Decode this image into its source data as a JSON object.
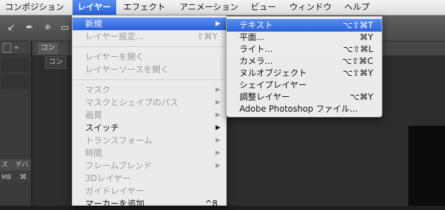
{
  "menubar": {
    "items": [
      {
        "label": "コンポジション"
      },
      {
        "label": "レイヤー"
      },
      {
        "label": "エフェクト"
      },
      {
        "label": "アニメーション"
      },
      {
        "label": "ビュー"
      },
      {
        "label": "ウィンドウ"
      },
      {
        "label": "ヘルプ"
      }
    ]
  },
  "panels": {
    "left_tab_1": "ズ",
    "left_tab_2": "デバ",
    "left_unit": "MB",
    "comp_tab": "コン",
    "comp_sub": "コン"
  },
  "layer_menu": {
    "items": [
      {
        "label": "新規",
        "shortcut": "",
        "submenu": true
      },
      {
        "label": "レイヤー設定...",
        "shortcut": "⇧⌘Y"
      },
      {
        "label": "レイヤーを開く",
        "shortcut": ""
      },
      {
        "label": "レイヤーソースを開く",
        "shortcut": ""
      },
      {
        "label": "マスク",
        "shortcut": "",
        "submenu": true
      },
      {
        "label": "マスクとシェイプのパス",
        "shortcut": "",
        "submenu": true
      },
      {
        "label": "画質",
        "shortcut": "",
        "submenu": true
      },
      {
        "label": "スイッチ",
        "shortcut": "",
        "submenu": true
      },
      {
        "label": "トランスフォーム",
        "shortcut": "",
        "submenu": true
      },
      {
        "label": "時間",
        "shortcut": "",
        "submenu": true
      },
      {
        "label": "フレームブレンド",
        "shortcut": "",
        "submenu": true
      },
      {
        "label": "3Dレイヤー",
        "shortcut": ""
      },
      {
        "label": "ガイドレイヤー",
        "shortcut": ""
      },
      {
        "label": "マーカーを追加",
        "shortcut": "^8"
      }
    ]
  },
  "new_submenu": {
    "items": [
      {
        "label": "テキスト",
        "shortcut": "⌥⇧⌘T"
      },
      {
        "label": "平面...",
        "shortcut": "⌘Y"
      },
      {
        "label": "ライト...",
        "shortcut": "⌥⇧⌘L"
      },
      {
        "label": "カメラ...",
        "shortcut": "⌥⇧⌘C"
      },
      {
        "label": "ヌルオブジェクト",
        "shortcut": "⌥⇧⌘Y"
      },
      {
        "label": "シェイプレイヤー",
        "shortcut": ""
      },
      {
        "label": "調整レイヤー",
        "shortcut": "⌥⌘Y"
      },
      {
        "label": "Adobe Photoshop ファイル...",
        "shortcut": ""
      }
    ]
  },
  "icons": {
    "submenu_arrow": "▶",
    "apple_icon": ""
  }
}
